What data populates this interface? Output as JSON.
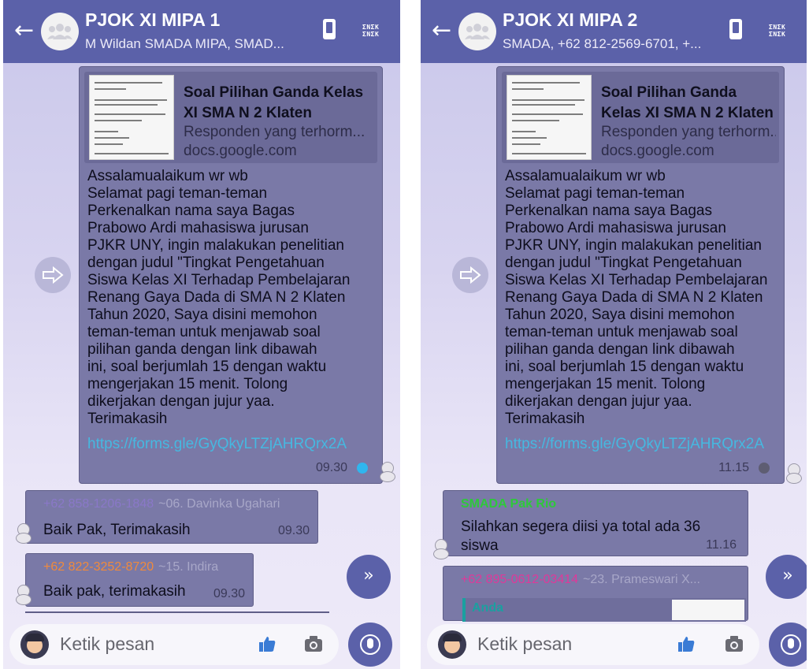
{
  "colors": {
    "header": "#5b61a9",
    "bubble": "#7a79a7",
    "link": "#46b8e0",
    "read_dot": "#2fb6ee",
    "sent_dot": "#5e5d72",
    "sender_orange": "#f08a3c",
    "sender_green": "#2ec93a",
    "sender_pink": "#e0389a",
    "sender_purple": "#8a78c8"
  },
  "left": {
    "header": {
      "title": "PJOK XI MIPA 1",
      "subtitle": "M Wildan SMADA MIPA, SMAD...",
      "back_icon": "arrow-left-icon",
      "avatar_icon": "group-icon",
      "call_icon": "phone-icon",
      "menu_logo": "ΣNΣK ΣNΣK"
    },
    "message": {
      "link_title": "Soal Pilihan Ganda Kelas XI SMA N 2 Klaten",
      "link_desc": "Responden yang terhorm...",
      "link_domain": "docs.google.com",
      "body": "Assalamualaikum wr wb\nSelamat pagi teman-teman\nPerkenalkan nama saya Bagas\nPrabowo Ardi mahasiswa jurusan\nPJKR UNY, ingin malakukan penelitian\ndengan judul \"Tingkat Pengetahuan\nSiswa Kelas XI Terhadap Pembelajaran\nRenang Gaya Dada di SMA N 2 Klaten\nTahun 2020, Saya disini memohon\nteman-teman untuk menjawab soal\npilihan ganda dengan link dibawah\nini, soal berjumlah 15 dengan waktu\nmengerjakan 15 menit. Tolong\ndikerjakan dengan jujur yaa.\nTerimakasih",
      "link_url": "https://forms.gle/GyQkyLTZjAHRQrx2A",
      "time": "09.30"
    },
    "replies": [
      {
        "sender": "+62 858-1206-1848",
        "alias": "~06. Davinka Ugahari",
        "text": "Baik Pak, Terimakasih",
        "time": "09.30"
      },
      {
        "sender": "+62 822-3252-8720",
        "alias": "~15. Indira",
        "text": "Baik pak, terimakasih",
        "time": "09.30"
      }
    ],
    "input": {
      "placeholder": "Ketik pesan"
    }
  },
  "right": {
    "header": {
      "title": "PJOK XI MIPA 2",
      "subtitle": "SMADA, +62 812-2569-6701, +...",
      "back_icon": "arrow-left-icon",
      "avatar_icon": "group-icon",
      "call_icon": "phone-icon",
      "menu_logo": "ΣNΣK ΣNΣK"
    },
    "message": {
      "link_title": "Soal Pilihan Ganda Kelas XI SMA N 2 Klaten",
      "link_desc": "Responden yang terhorm...",
      "link_domain": "docs.google.com",
      "body": "Assalamualaikum wr wb\nSelamat pagi teman-teman\nPerkenalkan nama saya Bagas\nPrabowo Ardi mahasiswa jurusan\nPJKR UNY, ingin malakukan penelitian\ndengan judul \"Tingkat Pengetahuan\nSiswa Kelas XI Terhadap Pembelajaran\nRenang Gaya Dada di SMA N 2 Klaten\nTahun 2020, Saya disini memohon\nteman-teman untuk menjawab soal\npilihan ganda dengan link dibawah\nini, soal berjumlah 15 dengan waktu\nmengerjakan 15 menit. Tolong\ndikerjakan dengan jujur yaa.\nTerimakasih",
      "link_url": "https://forms.gle/GyQkyLTZjAHRQrx2A",
      "time": "11.15"
    },
    "replies": [
      {
        "sender": "SMADA Pak Rio",
        "text": "Silahkan segera diisi ya total ada 36\nsiswa",
        "time": "11.16"
      },
      {
        "sender": "+62 895-0612-03414",
        "alias": "~23. Prameswari X...",
        "quote": "Anda"
      }
    ],
    "input": {
      "placeholder": "Ketik pesan"
    }
  }
}
